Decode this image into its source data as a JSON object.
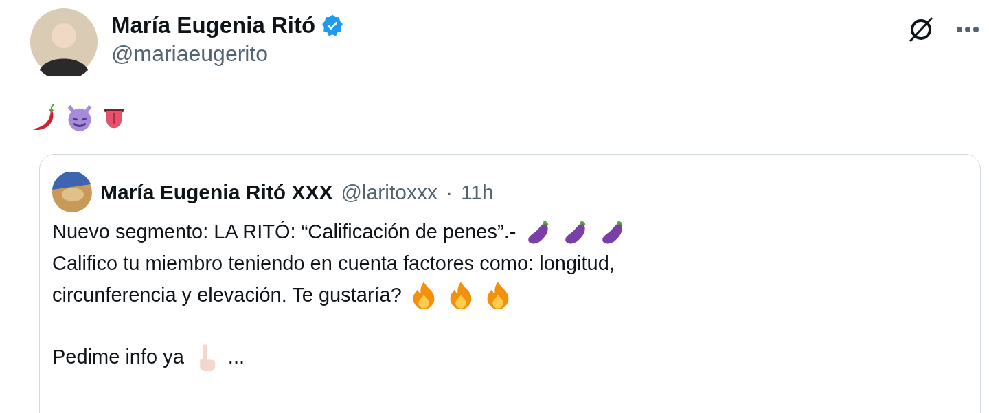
{
  "post": {
    "author": {
      "name": "María Eugenia Ritó",
      "verified": true,
      "handle": "@mariaeugerito"
    },
    "header_actions": [
      {
        "kind": "grok"
      },
      {
        "kind": "more"
      }
    ],
    "body": [
      [
        {
          "kind": "pepper"
        },
        {
          "kind": "devil"
        },
        {
          "kind": "tongue"
        }
      ]
    ],
    "quote": {
      "author": {
        "name": "María Eugenia Ritó XXX",
        "handle": "@laritoxxx",
        "separator": "·",
        "time": "11h"
      },
      "paragraphs": [
        [
          [
            {
              "kind": "text",
              "text": "Nuevo segmento: LA RITÓ: “Calificación de penes”.-"
            },
            {
              "kind": "eggplant"
            },
            {
              "kind": "eggplant"
            },
            {
              "kind": "eggplant"
            }
          ],
          [
            {
              "kind": "text",
              "text": "Califico tu miembro teniendo en cuenta factores como: longitud,"
            }
          ],
          [
            {
              "kind": "text",
              "text": "circunferencia y elevación. Te gustaría?"
            },
            {
              "kind": "fire"
            },
            {
              "kind": "fire"
            },
            {
              "kind": "fire"
            }
          ]
        ],
        [
          [
            {
              "kind": "text",
              "text": "Pedime info ya"
            },
            {
              "kind": "pointing"
            },
            {
              "kind": "text",
              "text": "..."
            }
          ]
        ]
      ]
    }
  }
}
